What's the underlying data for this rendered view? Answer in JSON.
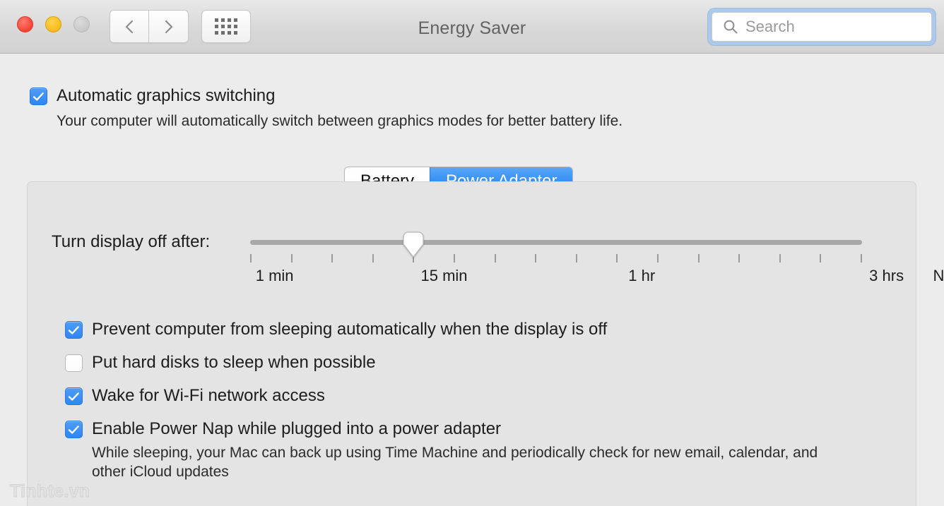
{
  "window": {
    "title": "Energy Saver",
    "traffic_lights": [
      "close",
      "minimize",
      "zoom"
    ],
    "nav_back_icon": "chevron-left-icon",
    "nav_forward_icon": "chevron-right-icon",
    "show_all_icon": "grid-icon"
  },
  "search": {
    "placeholder": "Search",
    "value": "",
    "icon": "search-icon",
    "focus_color": "#a9c9ee"
  },
  "graphics": {
    "checkbox_label": "Automatic graphics switching",
    "checked": true,
    "description": "Your computer will automatically switch between graphics modes for better battery life."
  },
  "tabs": {
    "items": [
      {
        "label": "Battery",
        "selected": false
      },
      {
        "label": "Power Adapter",
        "selected": true
      }
    ],
    "selected_color": "#1279ef"
  },
  "slider": {
    "label": "Turn display off after:",
    "value": "15 min",
    "tick_count": 16,
    "thumb_tick_index": 4,
    "tick_labels": [
      {
        "text": "1 min",
        "position_pct": 4
      },
      {
        "text": "15 min",
        "position_pct": 31.7
      },
      {
        "text": "1 hr",
        "position_pct": 64
      },
      {
        "text": "3 hrs",
        "position_pct": 104
      },
      {
        "text": "Never",
        "position_pct": 115
      }
    ]
  },
  "options": [
    {
      "label": "Prevent computer from sleeping automatically when the display is off",
      "checked": true,
      "description": ""
    },
    {
      "label": "Put hard disks to sleep when possible",
      "checked": false,
      "description": ""
    },
    {
      "label": "Wake for Wi-Fi network access",
      "checked": true,
      "description": ""
    },
    {
      "label": "Enable Power Nap while plugged into a power adapter",
      "checked": true,
      "description": "While sleeping, your Mac can back up using Time Machine and periodically check for new email, calendar, and other iCloud updates"
    }
  ],
  "watermark": "Tinhte.vn"
}
